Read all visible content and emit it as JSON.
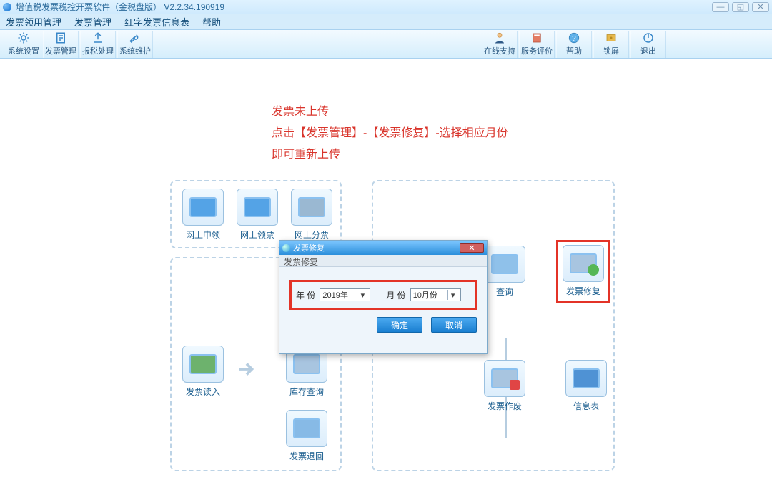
{
  "window": {
    "title": "增值税发票税控开票软件（金税盘版） V2.2.34.190919",
    "min": "—",
    "restore": "◱",
    "close": "✕"
  },
  "menu": {
    "items": [
      "发票领用管理",
      "发票管理",
      "红字发票信息表",
      "帮助"
    ]
  },
  "toolbar": {
    "left": [
      {
        "label": "系统设置",
        "icon": "gear"
      },
      {
        "label": "发票管理",
        "icon": "form"
      },
      {
        "label": "报税处理",
        "icon": "upload"
      },
      {
        "label": "系统维护",
        "icon": "wrench"
      }
    ],
    "right": [
      {
        "label": "在线支持",
        "icon": "person"
      },
      {
        "label": "服务评价",
        "icon": "book"
      },
      {
        "label": "帮助",
        "icon": "help"
      },
      {
        "label": "锁屏",
        "icon": "lock"
      },
      {
        "label": "退出",
        "icon": "power"
      }
    ]
  },
  "notice": {
    "line1": "发票未上传",
    "line2": "点击【发票管理】-【发票修复】-选择相应月份",
    "line3": "即可重新上传"
  },
  "tiles": {
    "ws_apply": "网上申领",
    "ws_receive": "网上领票",
    "ws_split": "网上分票",
    "fp_read": "发票读入",
    "stock_query": "库存查询",
    "fp_return": "发票退回",
    "query_trunc": "查询",
    "fp_void": "发票作废",
    "fp_repair": "发票修复",
    "info_table": "信息表"
  },
  "dialog": {
    "title": "发票修复",
    "subtitle": "发票修复",
    "year_label": "年 份",
    "year_value": "2019年",
    "month_label": "月 份",
    "month_value": "10月份",
    "ok": "确定",
    "cancel": "取消",
    "close_glyph": "✕"
  }
}
